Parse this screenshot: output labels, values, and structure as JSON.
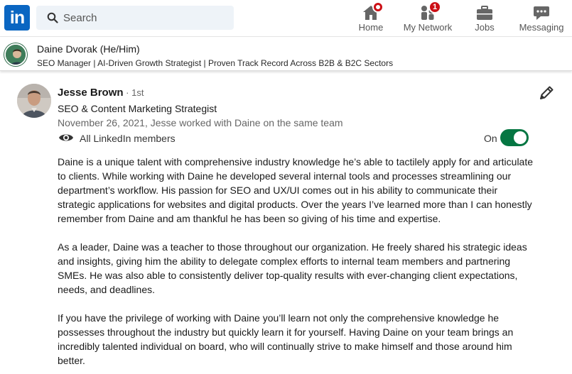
{
  "nav": {
    "logo_text": "in",
    "search_placeholder": "Search",
    "items": [
      {
        "label": "Home",
        "icon": "home-icon",
        "badge": ""
      },
      {
        "label": "My Network",
        "icon": "people-icon",
        "badge": "1"
      },
      {
        "label": "Jobs",
        "icon": "briefcase-icon",
        "badge": ""
      },
      {
        "label": "Messaging",
        "icon": "chat-icon",
        "badge": ""
      }
    ]
  },
  "profile_bar": {
    "name": "Daine Dvorak",
    "pronouns": "(He/Him)",
    "headline": "SEO Manager | AI-Driven Growth Strategist | Proven Track Record Across B2B & B2C Sectors"
  },
  "recommendation": {
    "recommender_name": "Jesse Brown",
    "degree": " · 1st",
    "recommender_title": "SEO & Content Marketing Strategist",
    "meta": "November 26, 2021, Jesse worked with Daine on the same team",
    "visibility_label": "All LinkedIn members",
    "toggle_label": "On",
    "toggle_on": true,
    "paragraphs": [
      "Daine is a unique talent with comprehensive industry knowledge he’s able to tactilely apply for and articulate to clients. While working with Daine he developed several internal tools and processes streamlining our department’s workflow. His passion for SEO and UX/UI comes out in his ability to communicate their strategic applications for websites and digital products. Over the years I’ve learned more than I can honestly remember from Daine and am thankful he has been so giving of his time and expertise.",
      "As a leader, Daine was a teacher to those throughout our organization. He freely shared his strategic ideas and insights, giving him the ability to delegate complex efforts to internal team members and partnering SMEs. He was also able to consistently deliver top-quality results with ever-changing client expectations, needs, and deadlines.",
      "If you have the privilege of working with Daine you’ll learn not only the comprehensive knowledge he possesses throughout the industry but quickly learn it for yourself. Having Daine on your team brings an incredibly talented individual on board, who will continually strive to make himself and those around him better."
    ]
  },
  "colors": {
    "brand": "#0a66c2",
    "badge": "#cc1016",
    "toggle_on": "#057642",
    "muted_text": "#666666"
  }
}
